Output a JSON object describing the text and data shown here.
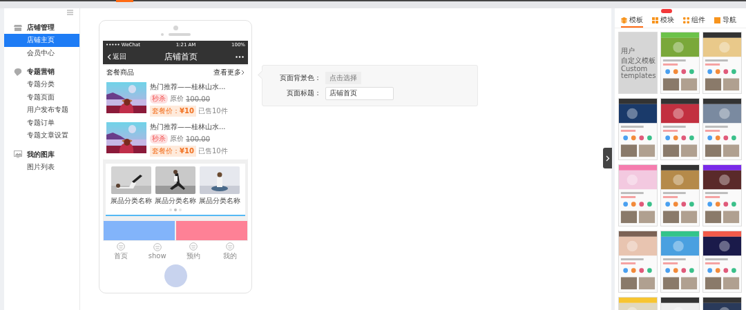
{
  "sidebar": {
    "groups": [
      {
        "title": "店铺管理",
        "items": [
          {
            "label": "店铺主页",
            "selected": true
          },
          {
            "label": "会员中心",
            "selected": false
          }
        ]
      },
      {
        "title": "专题营销",
        "items": [
          {
            "label": "专题分类",
            "selected": false
          },
          {
            "label": "专题页面",
            "selected": false
          },
          {
            "label": "用户发布专题",
            "selected": false
          },
          {
            "label": "专题订单",
            "selected": false
          },
          {
            "label": "专题文章设置",
            "selected": false
          }
        ]
      },
      {
        "title": "我的图库",
        "items": [
          {
            "label": "图片列表",
            "selected": false
          }
        ]
      }
    ]
  },
  "phone": {
    "status": {
      "carrier": "••••• WeChat",
      "time": "1:21 AM",
      "battery": "100%"
    },
    "nav": {
      "back": "返回",
      "title": "店铺首页"
    },
    "products": {
      "title": "套餐商品",
      "more": "查看更多",
      "items": [
        {
          "name": "热门推荐——桂林山水...",
          "tag": "秒杀",
          "original_label": "原价",
          "original_price": "100.00",
          "deal_label": "套餐价：",
          "deal_price": "¥10",
          "sold": "已售10件"
        },
        {
          "name": "热门推荐——桂林山水...",
          "tag": "秒杀",
          "original_label": "原价",
          "original_price": "100.00",
          "deal_label": "套餐价：",
          "deal_price": "¥10",
          "sold": "已售10件"
        }
      ]
    },
    "categories": {
      "items": [
        {
          "label": "展品分类名称"
        },
        {
          "label": "展品分类名称"
        },
        {
          "label": "展品分类名称"
        }
      ],
      "dots": [
        {
          "selected": false
        },
        {
          "selected": true
        },
        {
          "selected": false
        }
      ]
    },
    "blocks": [
      {
        "color": "#82b4fa"
      },
      {
        "color": "#fe8196"
      }
    ],
    "tabbar": [
      {
        "label": "首页"
      },
      {
        "label": "show"
      },
      {
        "label": "预约"
      },
      {
        "label": "我的"
      }
    ]
  },
  "settings": {
    "rows": [
      {
        "kind": "button",
        "label": "页面背景色：",
        "value": "点击选择"
      },
      {
        "kind": "input",
        "label": "页面标题：",
        "value": "店铺首页"
      }
    ]
  },
  "library": {
    "tabs": [
      {
        "label": "模板",
        "selected": true,
        "badge": false
      },
      {
        "label": "模块",
        "selected": false,
        "badge": true
      },
      {
        "label": "组件",
        "selected": false,
        "badge": false
      },
      {
        "label": "导航",
        "selected": false,
        "badge": false
      }
    ],
    "templates": [
      {
        "kind": "custom",
        "title": "用户",
        "subtitle": "自定义模板",
        "caption": "Custom templates"
      },
      {
        "kind": "picture"
      },
      {
        "kind": "picture"
      },
      {
        "kind": "picture"
      },
      {
        "kind": "picture"
      },
      {
        "kind": "picture"
      },
      {
        "kind": "picture"
      },
      {
        "kind": "picture"
      },
      {
        "kind": "picture"
      },
      {
        "kind": "picture"
      },
      {
        "kind": "picture"
      },
      {
        "kind": "picture"
      },
      {
        "kind": "picture"
      },
      {
        "kind": "picture"
      },
      {
        "kind": "picture"
      }
    ]
  }
}
